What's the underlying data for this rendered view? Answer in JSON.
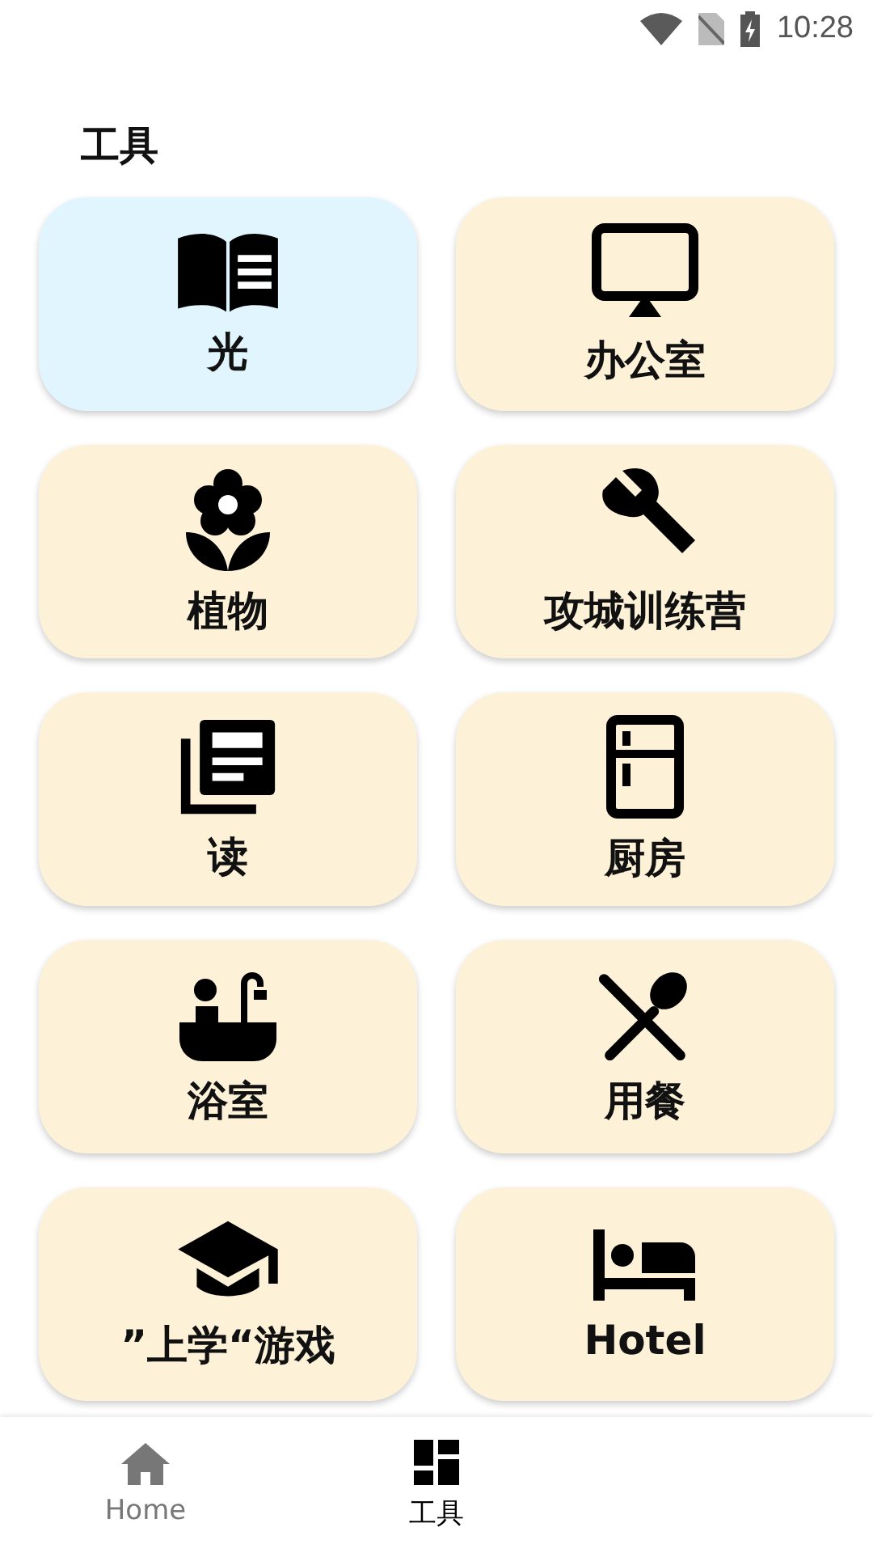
{
  "status_bar": {
    "time": "10:28"
  },
  "header": {
    "title": "工具"
  },
  "cards": [
    {
      "label": "光",
      "selected": true
    },
    {
      "label": "办公室",
      "selected": false
    },
    {
      "label": "植物",
      "selected": false
    },
    {
      "label": "攻城训练营",
      "selected": false
    },
    {
      "label": "读",
      "selected": false
    },
    {
      "label": "厨房",
      "selected": false
    },
    {
      "label": "浴室",
      "selected": false
    },
    {
      "label": "用餐",
      "selected": false
    },
    {
      "label": "”上学“游戏",
      "selected": false
    },
    {
      "label": "Hotel",
      "selected": false
    }
  ],
  "bottom_nav": [
    {
      "label": "Home",
      "selected": false
    },
    {
      "label": "工具",
      "selected": true
    }
  ]
}
